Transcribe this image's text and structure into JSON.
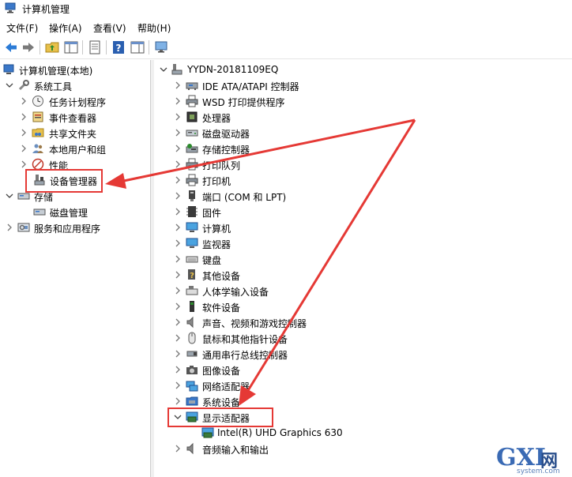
{
  "window": {
    "title": "计算机管理"
  },
  "menu": [
    "文件(F)",
    "操作(A)",
    "查看(V)",
    "帮助(H)"
  ],
  "toolbar": {
    "icons": [
      "back-icon",
      "forward-icon",
      "up-folder-icon",
      "show-tree-icon",
      "properties-icon",
      "help-icon",
      "action-pane-icon",
      "monitor-icon"
    ]
  },
  "left_tree": {
    "root": "计算机管理(本地)",
    "system_tools": "系统工具",
    "task_scheduler": "任务计划程序",
    "event_viewer": "事件查看器",
    "shared_folders": "共享文件夹",
    "local_users": "本地用户和组",
    "performance": "性能",
    "device_manager": "设备管理器",
    "storage": "存储",
    "disk_management": "磁盘管理",
    "services_apps": "服务和应用程序"
  },
  "device_tree": {
    "computer": "YYDN-20181109EQ",
    "categories": [
      "IDE ATA/ATAPI 控制器",
      "WSD 打印提供程序",
      "处理器",
      "磁盘驱动器",
      "存储控制器",
      "打印队列",
      "打印机",
      "端口 (COM 和 LPT)",
      "固件",
      "计算机",
      "监视器",
      "键盘",
      "其他设备",
      "人体学输入设备",
      "软件设备",
      "声音、视频和游戏控制器",
      "鼠标和其他指针设备",
      "通用串行总线控制器",
      "图像设备",
      "网络适配器",
      "系统设备",
      "显示适配器"
    ],
    "display_child": "Intel(R) UHD Graphics 630",
    "audio_io": "音频输入和输出"
  },
  "watermark": {
    "brand": "GXI",
    "cn": "网",
    "sub": "system.com"
  },
  "colors": {
    "highlight_red": "#e53935",
    "watermark_blue": "#3a6ab4"
  }
}
